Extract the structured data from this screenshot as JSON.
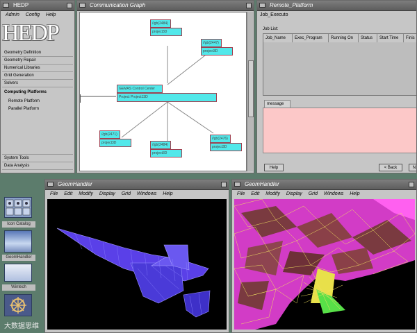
{
  "hedp": {
    "title": "HEDP",
    "menu": [
      "Admin",
      "Config",
      "Help"
    ],
    "logo_text": "HEDP",
    "nav_items": [
      "Geometry Definition",
      "Geometry Repair",
      "Numerical Libraries",
      "Grid Generation",
      "Solvers",
      "Computing Platforms"
    ],
    "sub_items": [
      "Remote Platform",
      "Parallel Platform"
    ],
    "bottom_items": [
      "System Tools",
      "Data Analysis"
    ]
  },
  "comm": {
    "title": "Communication Graph",
    "center": {
      "line1": "GEMAS Control Center",
      "line2": "Project  Project13D"
    },
    "nodes": [
      {
        "host": "//gb(2484)",
        "proj": "project3D"
      },
      {
        "host": "//gb(2447)",
        "proj": "project3D"
      },
      {
        "host": "//gb(2471)",
        "proj": "project3D"
      },
      {
        "host": "//gb(2484)",
        "proj": "project3D"
      },
      {
        "host": "//gb(2476)",
        "proj": "project3D"
      }
    ]
  },
  "remote": {
    "title": "Remote_Platform",
    "job_exec": "Job_Executo",
    "job_list": "Job List:",
    "columns": [
      "Job_Name",
      "Exec_Program",
      "Running On",
      "Status",
      "Start Time",
      "Finis"
    ],
    "message_tab": "message",
    "help": "Help",
    "back": "< Back",
    "next": "N"
  },
  "dock": {
    "labels": [
      "Icon Catalog",
      "GeomHandler",
      "Wintech"
    ]
  },
  "geom1": {
    "title": "GeomHandler",
    "menu": [
      "File",
      "Edit",
      "Modify",
      "Display",
      "Grid",
      "Windows",
      "Help"
    ]
  },
  "geom2": {
    "title": "GeomHandler",
    "menu": [
      "File",
      "Edit",
      "Modify",
      "Display",
      "Grid",
      "Windows",
      "Help"
    ]
  },
  "watermark": "大数据思维",
  "colors": {
    "node": "#52e8ea",
    "node_border": "#a04050",
    "message_bg": "#fcc8c8",
    "mesh_magenta": "#e040d0"
  }
}
